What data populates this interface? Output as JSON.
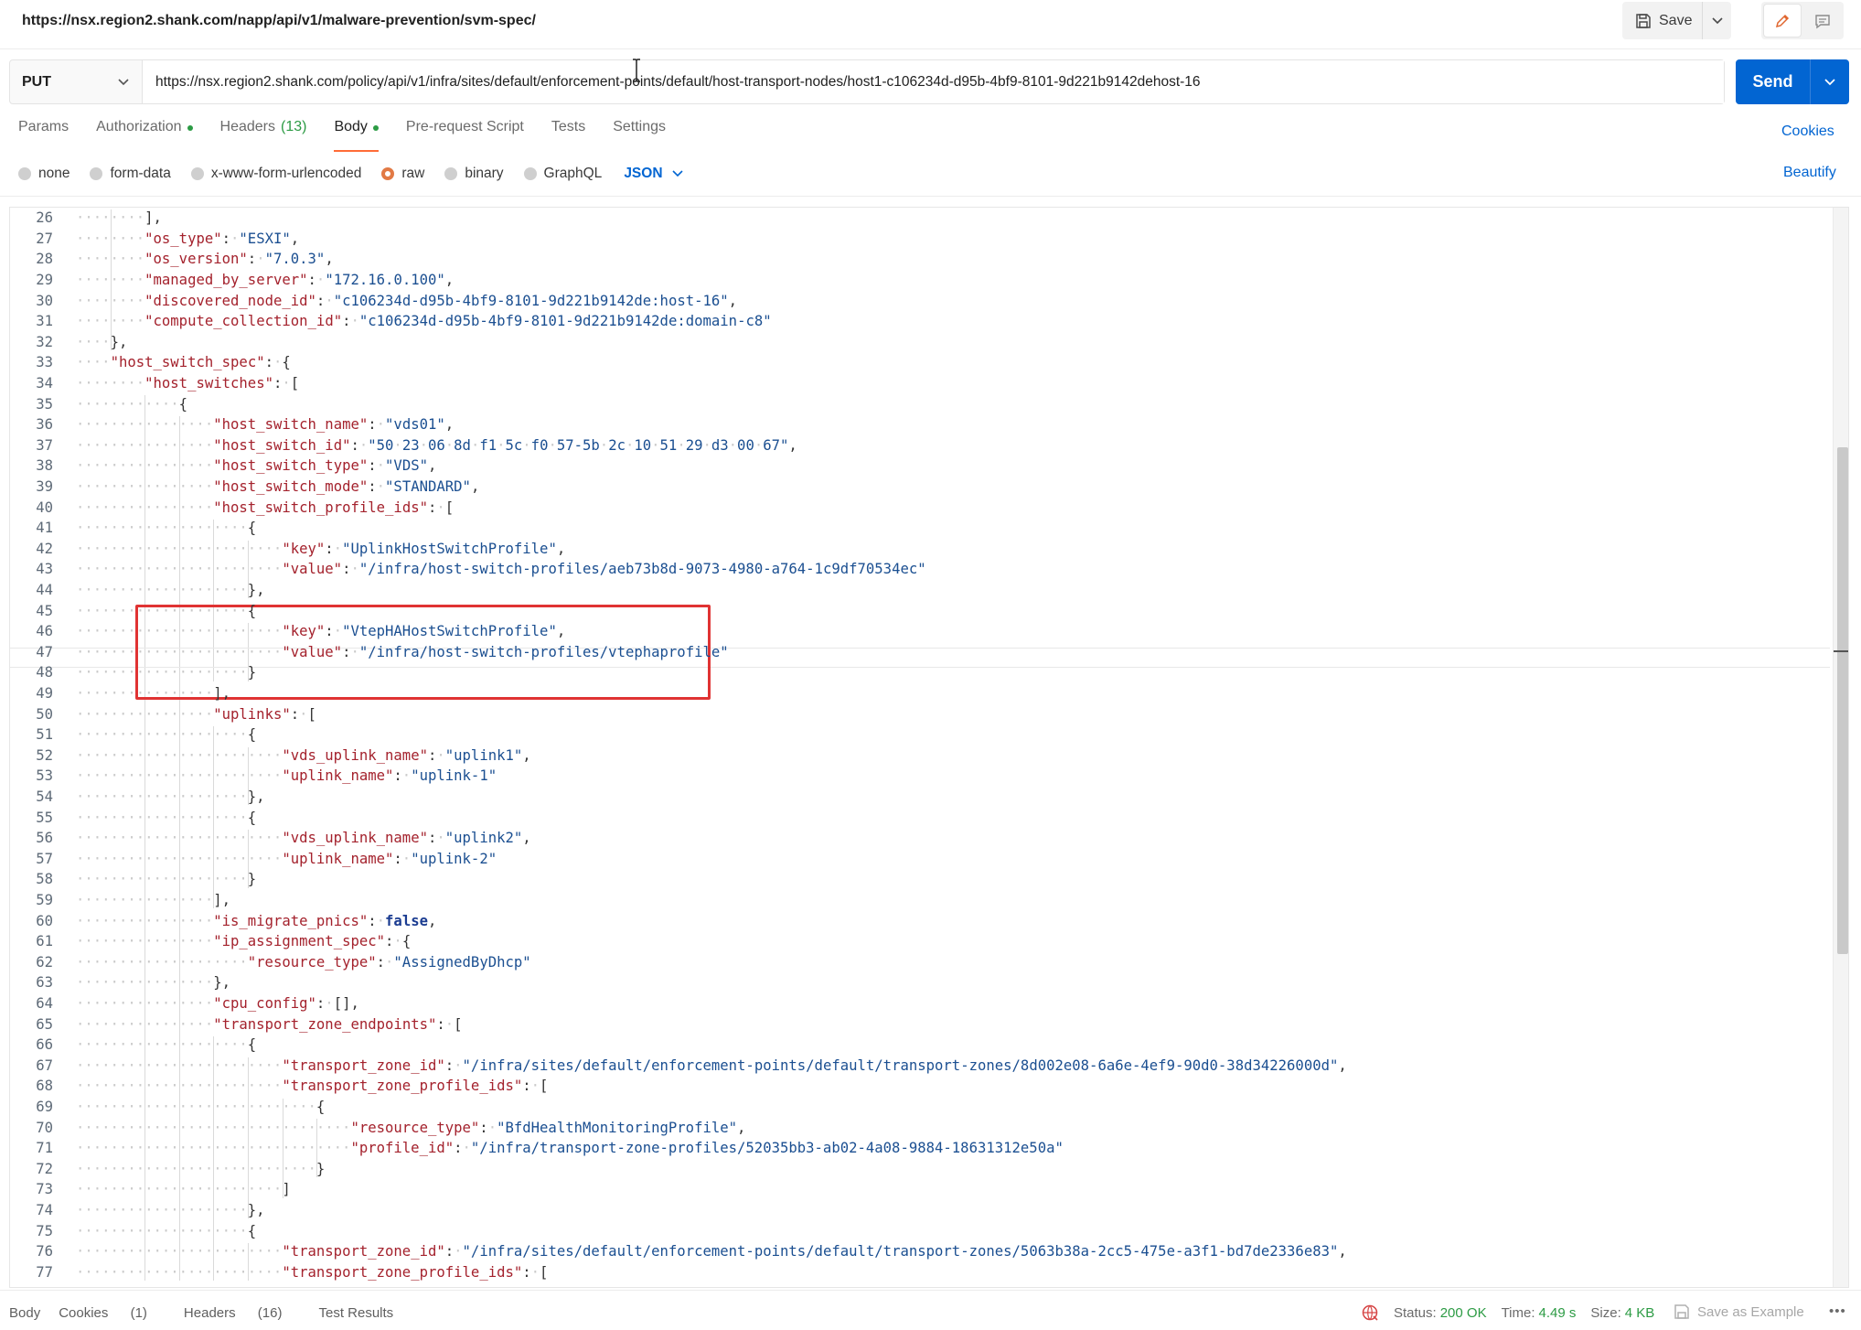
{
  "titlebar": {
    "url": "https://nsx.region2.shank.com/napp/api/v1/malware-prevention/svm-spec/",
    "save_label": "Save"
  },
  "request": {
    "method": "PUT",
    "url": "https://nsx.region2.shank.com/policy/api/v1/infra/sites/default/enforcement-points/default/host-transport-nodes/host1-c106234d-d95b-4bf9-8101-9d221b9142dehost-16",
    "send_label": "Send"
  },
  "tabs": {
    "params": "Params",
    "authorization": "Authorization",
    "headers": "Headers",
    "headers_count": "(13)",
    "body": "Body",
    "prerequest": "Pre-request Script",
    "tests": "Tests",
    "settings": "Settings",
    "cookies": "Cookies"
  },
  "body_types": {
    "none": "none",
    "form_data": "form-data",
    "urlencoded": "x-www-form-urlencoded",
    "raw": "raw",
    "binary": "binary",
    "graphql": "GraphQL",
    "format": "JSON",
    "beautify": "Beautify"
  },
  "editor": {
    "first_line_number": 26,
    "lines": [
      {
        "indent": 8,
        "tokens": [
          [
            "p",
            "],"
          ]
        ]
      },
      {
        "indent": 8,
        "tokens": [
          [
            "k",
            "\"os_type\""
          ],
          [
            "p",
            ": "
          ],
          [
            "s",
            "\"ESXI\""
          ],
          [
            "p",
            ","
          ]
        ]
      },
      {
        "indent": 8,
        "tokens": [
          [
            "k",
            "\"os_version\""
          ],
          [
            "p",
            ": "
          ],
          [
            "s",
            "\"7.0.3\""
          ],
          [
            "p",
            ","
          ]
        ]
      },
      {
        "indent": 8,
        "tokens": [
          [
            "k",
            "\"managed_by_server\""
          ],
          [
            "p",
            ": "
          ],
          [
            "s",
            "\"172.16.0.100\""
          ],
          [
            "p",
            ","
          ]
        ]
      },
      {
        "indent": 8,
        "tokens": [
          [
            "k",
            "\"discovered_node_id\""
          ],
          [
            "p",
            ": "
          ],
          [
            "s",
            "\"c106234d-d95b-4bf9-8101-9d221b9142de:host-16\""
          ],
          [
            "p",
            ","
          ]
        ]
      },
      {
        "indent": 8,
        "tokens": [
          [
            "k",
            "\"compute_collection_id\""
          ],
          [
            "p",
            ": "
          ],
          [
            "s",
            "\"c106234d-d95b-4bf9-8101-9d221b9142de:domain-c8\""
          ]
        ]
      },
      {
        "indent": 4,
        "tokens": [
          [
            "p",
            "},"
          ]
        ]
      },
      {
        "indent": 4,
        "tokens": [
          [
            "k",
            "\"host_switch_spec\""
          ],
          [
            "p",
            ": {"
          ]
        ]
      },
      {
        "indent": 8,
        "tokens": [
          [
            "k",
            "\"host_switches\""
          ],
          [
            "p",
            ": ["
          ]
        ]
      },
      {
        "indent": 12,
        "tokens": [
          [
            "p",
            "{"
          ]
        ]
      },
      {
        "indent": 16,
        "tokens": [
          [
            "k",
            "\"host_switch_name\""
          ],
          [
            "p",
            ": "
          ],
          [
            "s",
            "\"vds01\""
          ],
          [
            "p",
            ","
          ]
        ]
      },
      {
        "indent": 16,
        "tokens": [
          [
            "k",
            "\"host_switch_id\""
          ],
          [
            "p",
            ": "
          ],
          [
            "s",
            "\"50 23 06 8d f1 5c f0 57-5b 2c 10 51 29 d3 00 67\""
          ],
          [
            "p",
            ","
          ]
        ]
      },
      {
        "indent": 16,
        "tokens": [
          [
            "k",
            "\"host_switch_type\""
          ],
          [
            "p",
            ": "
          ],
          [
            "s",
            "\"VDS\""
          ],
          [
            "p",
            ","
          ]
        ]
      },
      {
        "indent": 16,
        "tokens": [
          [
            "k",
            "\"host_switch_mode\""
          ],
          [
            "p",
            ": "
          ],
          [
            "s",
            "\"STANDARD\""
          ],
          [
            "p",
            ","
          ]
        ]
      },
      {
        "indent": 16,
        "tokens": [
          [
            "k",
            "\"host_switch_profile_ids\""
          ],
          [
            "p",
            ": ["
          ]
        ]
      },
      {
        "indent": 20,
        "tokens": [
          [
            "p",
            "{"
          ]
        ]
      },
      {
        "indent": 24,
        "tokens": [
          [
            "k",
            "\"key\""
          ],
          [
            "p",
            ": "
          ],
          [
            "s",
            "\"UplinkHostSwitchProfile\""
          ],
          [
            "p",
            ","
          ]
        ]
      },
      {
        "indent": 24,
        "tokens": [
          [
            "k",
            "\"value\""
          ],
          [
            "p",
            ": "
          ],
          [
            "s",
            "\"/infra/host-switch-profiles/aeb73b8d-9073-4980-a764-1c9df70534ec\""
          ]
        ]
      },
      {
        "indent": 20,
        "tokens": [
          [
            "p",
            "},"
          ]
        ]
      },
      {
        "indent": 20,
        "tokens": [
          [
            "p",
            "{"
          ]
        ]
      },
      {
        "indent": 24,
        "tokens": [
          [
            "k",
            "\"key\""
          ],
          [
            "p",
            ": "
          ],
          [
            "s",
            "\"VtepHAHostSwitchProfile\""
          ],
          [
            "p",
            ","
          ]
        ]
      },
      {
        "indent": 24,
        "tokens": [
          [
            "k",
            "\"value\""
          ],
          [
            "p",
            ": "
          ],
          [
            "s",
            "\"/infra/host-switch-profiles/vtephaprofile\""
          ]
        ]
      },
      {
        "indent": 20,
        "tokens": [
          [
            "p",
            "}"
          ]
        ]
      },
      {
        "indent": 16,
        "tokens": [
          [
            "p",
            "],"
          ]
        ]
      },
      {
        "indent": 16,
        "tokens": [
          [
            "k",
            "\"uplinks\""
          ],
          [
            "p",
            ": ["
          ]
        ]
      },
      {
        "indent": 20,
        "tokens": [
          [
            "p",
            "{"
          ]
        ]
      },
      {
        "indent": 24,
        "tokens": [
          [
            "k",
            "\"vds_uplink_name\""
          ],
          [
            "p",
            ": "
          ],
          [
            "s",
            "\"uplink1\""
          ],
          [
            "p",
            ","
          ]
        ]
      },
      {
        "indent": 24,
        "tokens": [
          [
            "k",
            "\"uplink_name\""
          ],
          [
            "p",
            ": "
          ],
          [
            "s",
            "\"uplink-1\""
          ]
        ]
      },
      {
        "indent": 20,
        "tokens": [
          [
            "p",
            "},"
          ]
        ]
      },
      {
        "indent": 20,
        "tokens": [
          [
            "p",
            "{"
          ]
        ]
      },
      {
        "indent": 24,
        "tokens": [
          [
            "k",
            "\"vds_uplink_name\""
          ],
          [
            "p",
            ": "
          ],
          [
            "s",
            "\"uplink2\""
          ],
          [
            "p",
            ","
          ]
        ]
      },
      {
        "indent": 24,
        "tokens": [
          [
            "k",
            "\"uplink_name\""
          ],
          [
            "p",
            ": "
          ],
          [
            "s",
            "\"uplink-2\""
          ]
        ]
      },
      {
        "indent": 20,
        "tokens": [
          [
            "p",
            "}"
          ]
        ]
      },
      {
        "indent": 16,
        "tokens": [
          [
            "p",
            "],"
          ]
        ]
      },
      {
        "indent": 16,
        "tokens": [
          [
            "k",
            "\"is_migrate_pnics\""
          ],
          [
            "p",
            ": "
          ],
          [
            "kw",
            "false"
          ],
          [
            "p",
            ","
          ]
        ]
      },
      {
        "indent": 16,
        "tokens": [
          [
            "k",
            "\"ip_assignment_spec\""
          ],
          [
            "p",
            ": {"
          ]
        ]
      },
      {
        "indent": 20,
        "tokens": [
          [
            "k",
            "\"resource_type\""
          ],
          [
            "p",
            ": "
          ],
          [
            "s",
            "\"AssignedByDhcp\""
          ]
        ]
      },
      {
        "indent": 16,
        "tokens": [
          [
            "p",
            "},"
          ]
        ]
      },
      {
        "indent": 16,
        "tokens": [
          [
            "k",
            "\"cpu_config\""
          ],
          [
            "p",
            ": [],"
          ]
        ]
      },
      {
        "indent": 16,
        "tokens": [
          [
            "k",
            "\"transport_zone_endpoints\""
          ],
          [
            "p",
            ": ["
          ]
        ]
      },
      {
        "indent": 20,
        "tokens": [
          [
            "p",
            "{"
          ]
        ]
      },
      {
        "indent": 24,
        "tokens": [
          [
            "k",
            "\"transport_zone_id\""
          ],
          [
            "p",
            ": "
          ],
          [
            "s",
            "\"/infra/sites/default/enforcement-points/default/transport-zones/8d002e08-6a6e-4ef9-90d0-38d34226000d\""
          ],
          [
            "p",
            ","
          ]
        ]
      },
      {
        "indent": 24,
        "tokens": [
          [
            "k",
            "\"transport_zone_profile_ids\""
          ],
          [
            "p",
            ": ["
          ]
        ]
      },
      {
        "indent": 28,
        "tokens": [
          [
            "p",
            "{"
          ]
        ]
      },
      {
        "indent": 32,
        "tokens": [
          [
            "k",
            "\"resource_type\""
          ],
          [
            "p",
            ": "
          ],
          [
            "s",
            "\"BfdHealthMonitoringProfile\""
          ],
          [
            "p",
            ","
          ]
        ]
      },
      {
        "indent": 32,
        "tokens": [
          [
            "k",
            "\"profile_id\""
          ],
          [
            "p",
            ": "
          ],
          [
            "s",
            "\"/infra/transport-zone-profiles/52035bb3-ab02-4a08-9884-18631312e50a\""
          ]
        ]
      },
      {
        "indent": 28,
        "tokens": [
          [
            "p",
            "}"
          ]
        ]
      },
      {
        "indent": 24,
        "tokens": [
          [
            "p",
            "]"
          ]
        ]
      },
      {
        "indent": 20,
        "tokens": [
          [
            "p",
            "},"
          ]
        ]
      },
      {
        "indent": 20,
        "tokens": [
          [
            "p",
            "{"
          ]
        ]
      },
      {
        "indent": 24,
        "tokens": [
          [
            "k",
            "\"transport_zone_id\""
          ],
          [
            "p",
            ": "
          ],
          [
            "s",
            "\"/infra/sites/default/enforcement-points/default/transport-zones/5063b38a-2cc5-475e-a3f1-bd7de2336e83\""
          ],
          [
            "p",
            ","
          ]
        ]
      },
      {
        "indent": 24,
        "tokens": [
          [
            "k",
            "\"transport_zone_profile_ids\""
          ],
          [
            "p",
            ": ["
          ]
        ]
      }
    ]
  },
  "response": {
    "tab_body": "Body",
    "tab_cookies": "Cookies",
    "cookies_count": "(1)",
    "tab_headers": "Headers",
    "headers_count": "(16)",
    "tab_tests": "Test Results",
    "status_label": "Status:",
    "status_value": "200 OK",
    "time_label": "Time:",
    "time_value": "4.49 s",
    "size_label": "Size:",
    "size_value": "4 KB",
    "save_example": "Save as Example"
  },
  "colors": {
    "accent": "#ff6c37",
    "send": "#0265d2",
    "highlight": "#e03333",
    "success": "#2c9b44"
  }
}
